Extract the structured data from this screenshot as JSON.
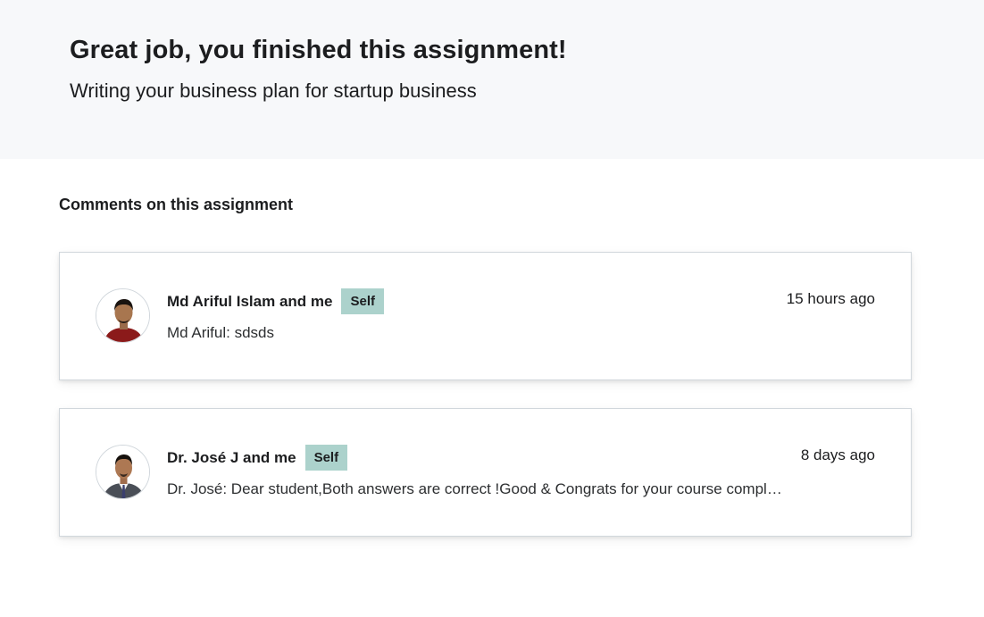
{
  "hero": {
    "title": "Great job, you finished this assignment!",
    "subtitle": "Writing your business plan for startup business"
  },
  "comments_section": {
    "heading": "Comments on this assignment",
    "comments": [
      {
        "author": "Md Ariful Islam and me",
        "badge": "Self",
        "timestamp": "15 hours ago",
        "message": "Md Ariful: sdsds"
      },
      {
        "author": "Dr. José J and me",
        "badge": "Self",
        "timestamp": "8 days ago",
        "message": "Dr. José: Dear student,Both answers are correct !Good & Congrats for your course completion."
      }
    ]
  },
  "colors": {
    "hero_bg": "#f7f8fa",
    "badge_bg": "#acd2cc",
    "text": "#1c1d1f"
  }
}
